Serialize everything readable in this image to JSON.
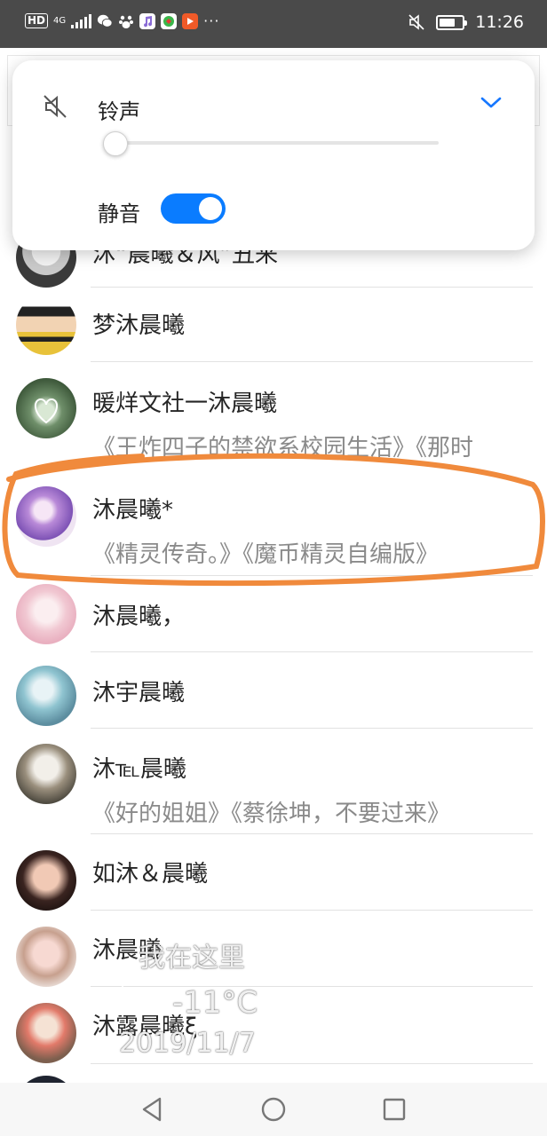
{
  "status_bar": {
    "hd": "HD",
    "net": "4G",
    "more": "···",
    "time": "11:26",
    "icons": [
      "wechat-icon",
      "baidu-icon",
      "music-icon",
      "app-icon",
      "video-icon"
    ]
  },
  "volume_panel": {
    "label": "铃声",
    "silent_label": "静音",
    "silent_on": true,
    "volume_level": 0,
    "accent_color": "#0a7cff"
  },
  "contacts": [
    {
      "name": "沐“晨曦＆风”丑来",
      "sub": ""
    },
    {
      "name": "梦沐晨曦",
      "sub": ""
    },
    {
      "name": "暖烊文社一沐晨曦",
      "sub": "《王炸四子的禁欲系校园生活》《那时"
    },
    {
      "name": "沐晨曦*",
      "sub": "《精灵传奇。》《魔币精灵自编版》"
    },
    {
      "name": "沐晨曦，",
      "sub": ""
    },
    {
      "name": "沐宇晨曦",
      "sub": ""
    },
    {
      "name": "沐℡晨曦",
      "sub": "《好的姐姐》《蔡徐坤，不要过来》"
    },
    {
      "name": "如沐＆晨曦",
      "sub": ""
    },
    {
      "name": "沐晨曦",
      "sub": ""
    },
    {
      "name": "沐露晨曦ξ",
      "sub": ""
    }
  ],
  "highlight_color": "#f08a3c",
  "watermark": {
    "location": "我在这里",
    "temp": "-11°C",
    "date": "2019/11/7"
  }
}
